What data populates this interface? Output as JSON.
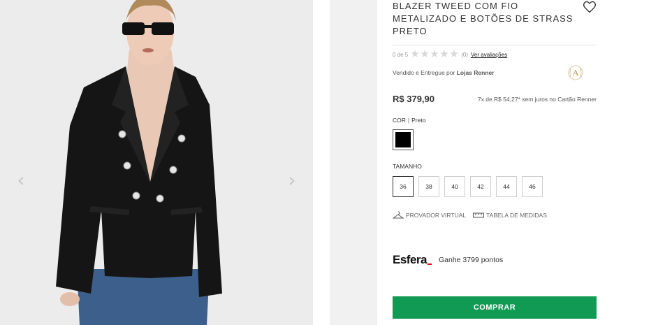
{
  "product": {
    "title": "BLAZER TWEED COM FIO METALIZADO E BOTÕES DE STRASS PRETO",
    "rating": {
      "score_text": "0 de 5",
      "stars_filled": 0,
      "stars_total": 5,
      "review_count": "(0)",
      "reviews_link": "Ver avaliações"
    },
    "seller": {
      "prefix": "Vendido e Entregue por",
      "name": "Lojas Renner",
      "badge_letter": "A"
    },
    "price": "R$ 379,90",
    "installments": "7x de R$ 54,27* sem juros no Cartão Renner",
    "color": {
      "label": "COR",
      "separator": "|",
      "value": "Preto",
      "swatch_hex": "#000000"
    },
    "size": {
      "label": "TAMANHO",
      "options": [
        "36",
        "38",
        "40",
        "42",
        "44",
        "46"
      ],
      "selected": "36"
    },
    "tools": {
      "virtual_fitting": "PROVADOR VIRTUAL",
      "size_chart": "TABELA DE MEDIDAS"
    },
    "loyalty": {
      "brand": "Esfera",
      "text": "Ganhe 3799 pontos"
    },
    "buy_label": "COMPRAR"
  },
  "gallery": {
    "prev_arrow": "‹",
    "next_arrow": "›"
  },
  "colors": {
    "buy_button": "#119a54",
    "esfera_accent": "#e30613",
    "gallery_bg": "#eeeeee"
  },
  "icons": [
    "heart-icon",
    "star-icon",
    "seller-badge-icon",
    "hanger-icon",
    "ruler-icon"
  ]
}
